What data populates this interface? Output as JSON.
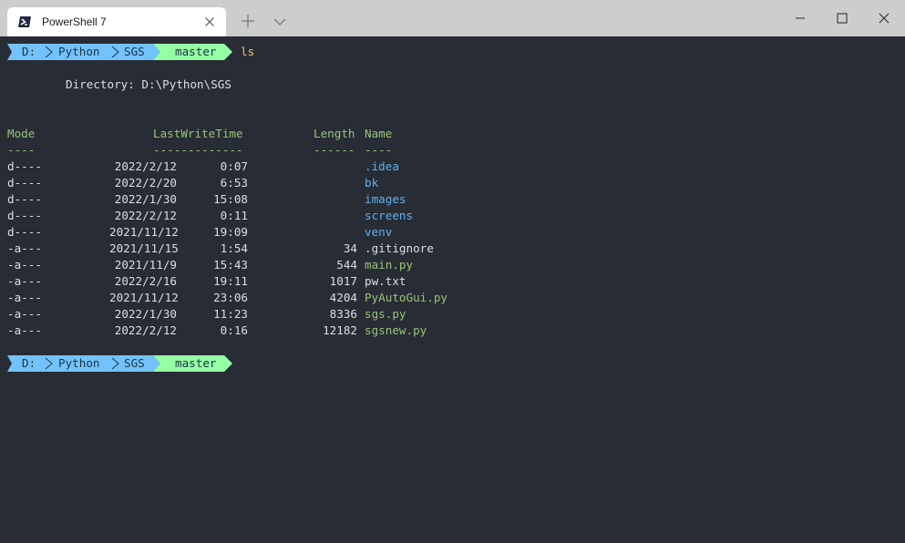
{
  "window": {
    "tab_title": "PowerShell 7",
    "icons": {
      "tab": "powershell-icon",
      "close_tab": "close-icon",
      "new_tab": "plus-icon",
      "dropdown": "chevron-down-icon",
      "minimize": "minimize-icon",
      "maximize": "maximize-icon",
      "close": "close-icon"
    }
  },
  "prompt": {
    "drive": "D:",
    "folder1": "Python",
    "folder2": "SGS",
    "branch": "master",
    "git_glyph": "",
    "colors": {
      "path": "#73c2fb",
      "git": "#95ffa4",
      "text": "#193549"
    }
  },
  "command": "ls",
  "directory_line": "Directory: D:\\Python\\SGS",
  "table": {
    "headers": {
      "mode": "Mode",
      "lastwrite": "LastWriteTime",
      "length": "Length",
      "name": "Name"
    },
    "underlines": {
      "mode": "----",
      "lastwrite": "-------------",
      "length": "------",
      "name": "----"
    },
    "rows": [
      {
        "mode": "d----",
        "date": "2022/2/12",
        "time": "0:07",
        "length": "",
        "name": "idea",
        "kind": "dir"
      },
      {
        "mode": "d----",
        "date": "2022/2/20",
        "time": "6:53",
        "length": "",
        "name": "bk",
        "kind": "dir"
      },
      {
        "mode": "d----",
        "date": "2022/1/30",
        "time": "15:08",
        "length": "",
        "name": "images",
        "kind": "dir"
      },
      {
        "mode": "d----",
        "date": "2022/2/12",
        "time": "0:11",
        "length": "",
        "name": "screens",
        "kind": "dir"
      },
      {
        "mode": "d----",
        "date": "2021/11/12",
        "time": "19:09",
        "length": "",
        "name": "venv",
        "kind": "dir"
      },
      {
        "mode": "-a---",
        "date": "2021/11/15",
        "time": "1:54",
        "length": "34",
        "name": ".gitignore",
        "kind": "plain"
      },
      {
        "mode": "-a---",
        "date": "2021/11/9",
        "time": "15:43",
        "length": "544",
        "name": "main.py",
        "kind": "py"
      },
      {
        "mode": "-a---",
        "date": "2022/2/16",
        "time": "19:11",
        "length": "1017",
        "name": "pw.txt",
        "kind": "plain"
      },
      {
        "mode": "-a---",
        "date": "2021/11/12",
        "time": "23:06",
        "length": "4204",
        "name": "PyAutoGui.py",
        "kind": "py"
      },
      {
        "mode": "-a---",
        "date": "2022/1/30",
        "time": "11:23",
        "length": "8336",
        "name": "sgs.py",
        "kind": "py"
      },
      {
        "mode": "-a---",
        "date": "2022/2/12",
        "time": "0:16",
        "length": "12182",
        "name": "sgsnew.py",
        "kind": "py"
      }
    ]
  },
  "colors": {
    "background": "#282c34",
    "command": "#e5c07b",
    "header": "#98c379",
    "directory": "#61afef",
    "python_file": "#98c379",
    "plain_text": "#dcdfe4"
  }
}
